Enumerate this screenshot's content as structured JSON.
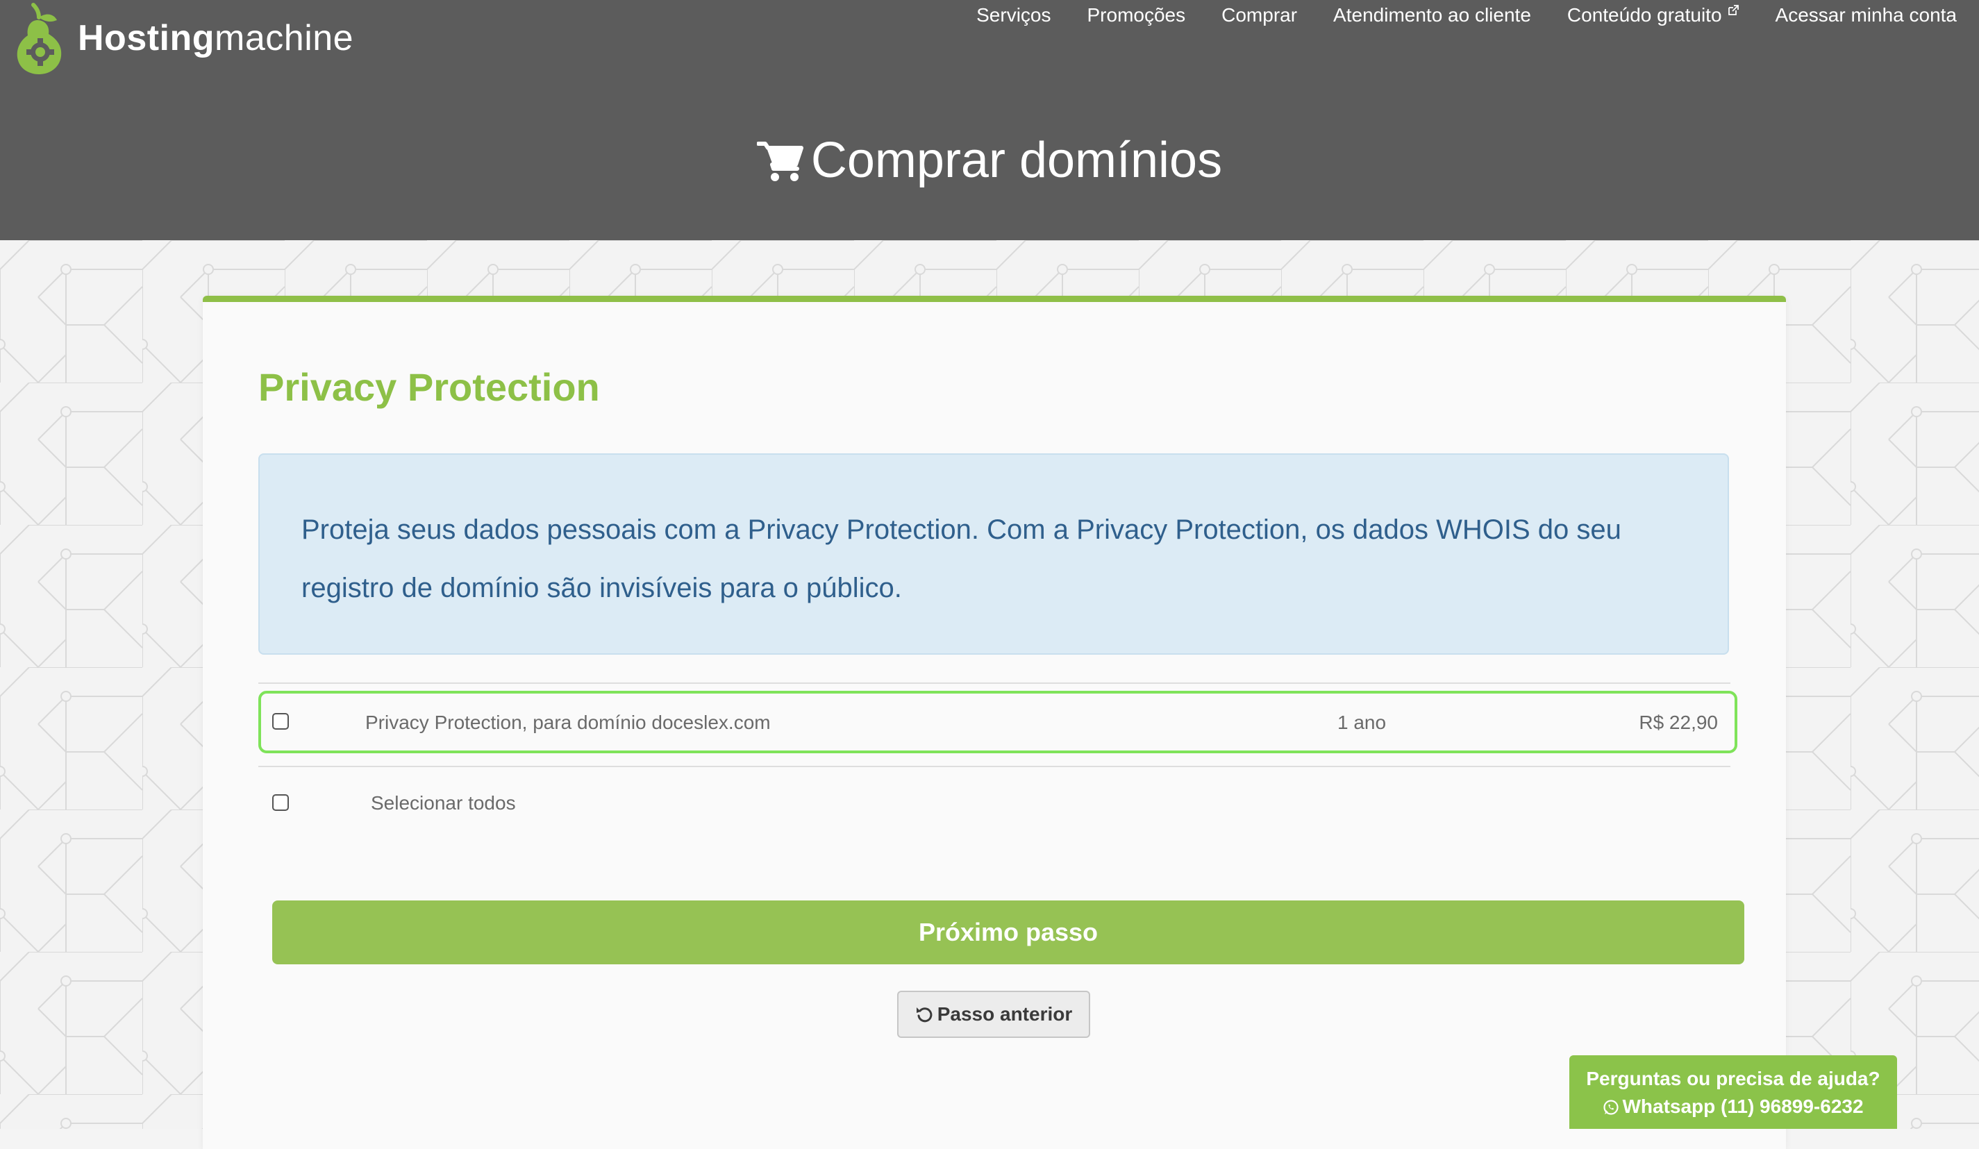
{
  "logo": {
    "bold_text": "Hosting",
    "light_text": "machine",
    "icon": "pear-gear-icon"
  },
  "nav": {
    "items": [
      {
        "label": "Serviços"
      },
      {
        "label": "Promoções"
      },
      {
        "label": "Comprar"
      },
      {
        "label": "Atendimento ao cliente"
      },
      {
        "label": "Conteúdo gratuito",
        "icon": "external-link-icon"
      },
      {
        "label": "Acessar minha conta"
      }
    ]
  },
  "page": {
    "title": "Comprar domínios",
    "title_icon": "cart-icon"
  },
  "card": {
    "heading": "Privacy Protection",
    "info": "Proteja seus dados pessoais com a Privacy Protection. Com a Privacy Protection, os dados WHOIS do seu registro de domínio são invisíveis para o público.",
    "option": {
      "label": "Privacy Protection, para domínio doceslex.com",
      "period": "1 ano",
      "price": "R$ 22,90",
      "checked": false
    },
    "select_all": {
      "label": "Selecionar todos",
      "checked": false
    },
    "next_button": "Próximo passo",
    "prev_button": "Passo anterior",
    "prev_icon": "undo-icon"
  },
  "help": {
    "line1": "Perguntas ou precisa de ajuda?",
    "line2": "Whatsapp (11) 96899-6232",
    "icon": "whatsapp-icon"
  },
  "colors": {
    "header_bg": "#5c5c5c",
    "accent_green": "#8dc047",
    "button_green": "#96c254",
    "info_bg": "#dcebf5",
    "info_text": "#2f5f8c",
    "highlight_border": "#7fe35a"
  }
}
